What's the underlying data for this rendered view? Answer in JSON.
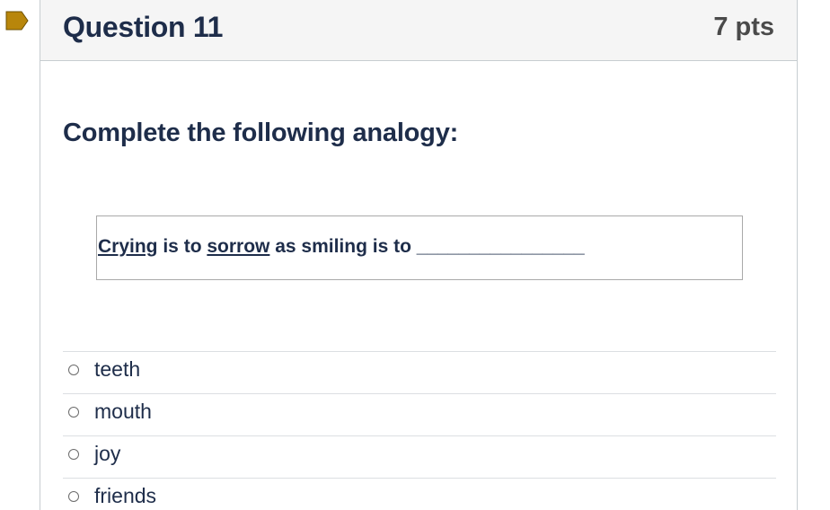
{
  "question": {
    "title": "Question 11",
    "points": "7 pts",
    "prompt": "Complete the following analogy:",
    "analogy": {
      "word1": "Crying",
      "text1": " is to ",
      "word2": "sorrow",
      "text2": " as smiling is to ",
      "blank": "________________"
    },
    "flag_icon": "bookmark-flag-icon",
    "flag_color": "#b8860b"
  },
  "answers": [
    {
      "label": "teeth",
      "selected": false
    },
    {
      "label": "mouth",
      "selected": false
    },
    {
      "label": "joy",
      "selected": false
    },
    {
      "label": "friends",
      "selected": false
    }
  ]
}
